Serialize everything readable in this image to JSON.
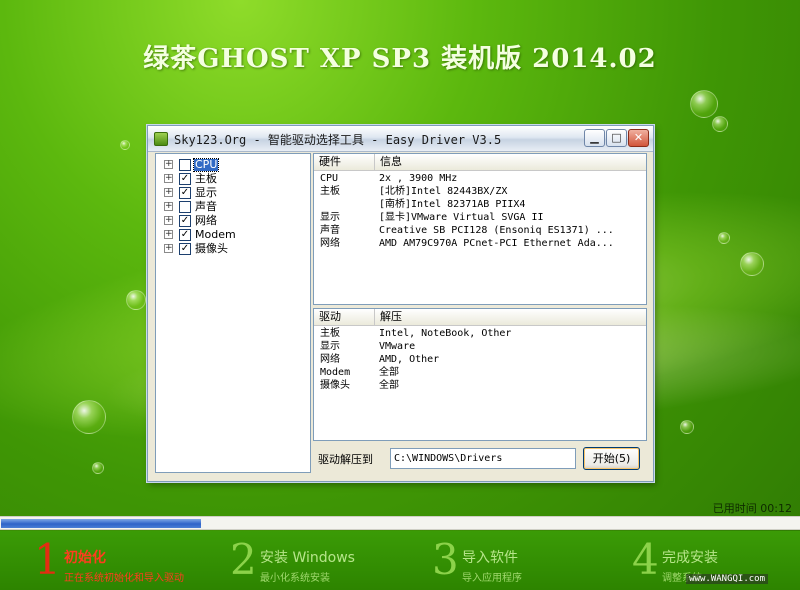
{
  "banner": {
    "title": "绿茶GHOST XP SP3 装机版 2014.02"
  },
  "window": {
    "title": "Sky123.Org - 智能驱动选择工具 - Easy Driver V3.5",
    "controls": {
      "minimize": "▁",
      "maximize": "□",
      "close": "✕"
    }
  },
  "tree": {
    "items": [
      {
        "label": "CPU",
        "checked": false,
        "selected": true
      },
      {
        "label": "主板",
        "checked": true,
        "selected": false
      },
      {
        "label": "显示",
        "checked": true,
        "selected": false
      },
      {
        "label": "声音",
        "checked": false,
        "selected": false
      },
      {
        "label": "网络",
        "checked": true,
        "selected": false
      },
      {
        "label": "Modem",
        "checked": true,
        "selected": false
      },
      {
        "label": "摄像头",
        "checked": true,
        "selected": false
      }
    ],
    "expander": "+"
  },
  "hardware": {
    "header": [
      "硬件",
      "信息"
    ],
    "rows": [
      [
        "CPU",
        "2x , 3900 MHz"
      ],
      [
        "主板",
        "[北桥]Intel 82443BX/ZX"
      ],
      [
        "",
        "[南桥]Intel 82371AB PIIX4"
      ],
      [
        "显示",
        "[显卡]VMware Virtual SVGA II"
      ],
      [
        "声音",
        "Creative SB PCI128 (Ensoniq ES1371) ..."
      ],
      [
        "网络",
        "AMD AM79C970A PCnet-PCI Ethernet Ada..."
      ]
    ]
  },
  "drivers": {
    "header": [
      "驱动",
      "解压"
    ],
    "rows": [
      [
        "主板",
        "Intel, NoteBook, Other"
      ],
      [
        "显示",
        "VMware"
      ],
      [
        "网络",
        "AMD, Other"
      ],
      [
        "Modem",
        "全部"
      ],
      [
        "摄像头",
        "全部"
      ]
    ]
  },
  "extract": {
    "label": "驱动解压到",
    "path": "C:\\WINDOWS\\Drivers",
    "start_button": "开始(5)"
  },
  "status": {
    "elapsed": "已用时间 00:12",
    "progress_fraction": 0.25
  },
  "steps": [
    {
      "num": "1",
      "title": "初始化",
      "sub": "正在系统初始化和导入驱动",
      "active": true
    },
    {
      "num": "2",
      "title": "安装 Windows",
      "sub": "最小化系统安装",
      "active": false
    },
    {
      "num": "3",
      "title": "导入软件",
      "sub": "导入应用程序",
      "active": false
    },
    {
      "num": "4",
      "title": "完成安装",
      "sub": "调整系统",
      "active": false
    }
  ],
  "watermark": "www.WANGQI.com",
  "colors": {
    "active_step": "#ff3d1f",
    "progress": "#2f63c8",
    "selection": "#316ac5"
  }
}
